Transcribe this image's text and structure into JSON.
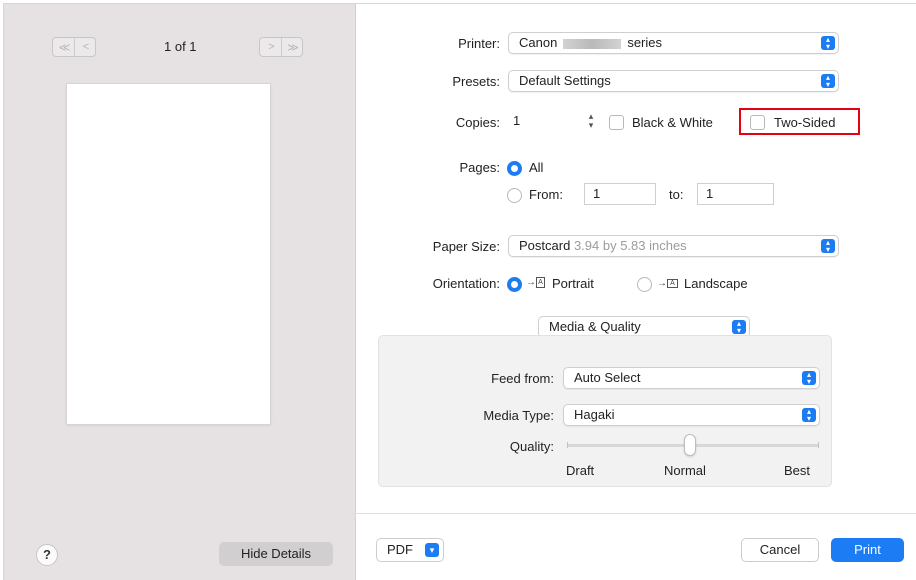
{
  "preview": {
    "page_counter": "1 of 1",
    "first_prev_glyphs": [
      "≪",
      "<"
    ],
    "next_last_glyphs": [
      ">",
      "≫"
    ],
    "help_label": "?",
    "hide_details_label": "Hide Details"
  },
  "printer": {
    "label": "Printer:",
    "value_prefix": "Canon",
    "value_suffix": "series"
  },
  "presets": {
    "label": "Presets:",
    "value": "Default Settings"
  },
  "copies": {
    "label": "Copies:",
    "value": "1",
    "black_white_label": "Black & White",
    "two_sided_label": "Two-Sided"
  },
  "pages": {
    "label": "Pages:",
    "all_label": "All",
    "from_label": "From:",
    "from_value": "1",
    "to_label": "to:",
    "to_value": "1",
    "selected": "All"
  },
  "paper_size": {
    "label": "Paper Size:",
    "value": "Postcard",
    "dimensions": "3.94 by 5.83 inches"
  },
  "orientation": {
    "label": "Orientation:",
    "portrait_label": "Portrait",
    "landscape_label": "Landscape",
    "selected": "Portrait"
  },
  "section_menu": {
    "value": "Media & Quality"
  },
  "media_quality": {
    "feed_from_label": "Feed from:",
    "feed_from_value": "Auto Select",
    "media_type_label": "Media Type:",
    "media_type_value": "Hagaki",
    "quality_label": "Quality:",
    "quality_levels": [
      "Draft",
      "Normal",
      "Best"
    ],
    "quality_selected": "Normal"
  },
  "footer": {
    "pdf_label": "PDF",
    "cancel_label": "Cancel",
    "print_label": "Print"
  },
  "colors": {
    "accent": "#1c7cf4",
    "highlight_box": "#e60012"
  }
}
